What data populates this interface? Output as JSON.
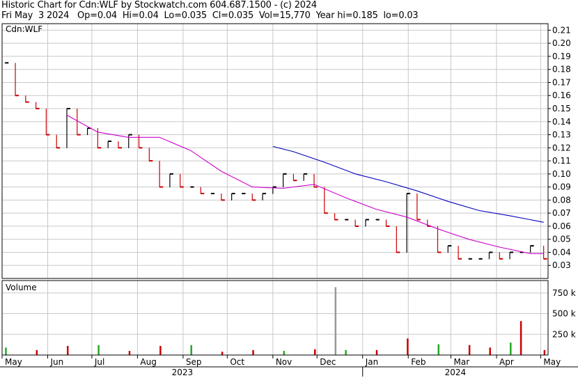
{
  "header": {
    "line1": "Historic Chart for Cdn:WLF by Stockwatch.com 604.687.1500 - (c) 2024",
    "line2": "Fri May  3 2024   Op=0.04  Hi=0.04  Lo=0.035  Cl=0.035  Vol=15,770  Year hi=0.185  lo=0.03"
  },
  "price_panel": {
    "symbol_label": "Cdn:WLF"
  },
  "volume_panel": {
    "label": "Volume"
  },
  "colors": {
    "up": "#000000",
    "down": "#cc0000",
    "ma_short": "#cc00cc",
    "ma_long": "#0000bb",
    "grid": "#c8c8c8"
  },
  "chart_data": {
    "type": "line",
    "title": "Historic Chart for Cdn:WLF",
    "x_axis": {
      "months": [
        "May",
        "Jun",
        "Jul",
        "Aug",
        "Sep",
        "Oct",
        "Nov",
        "Dec",
        "Jan",
        "Feb",
        "Mar",
        "Apr",
        "May"
      ],
      "years": [
        "2023",
        "2024"
      ]
    },
    "y_axis": {
      "ylim": [
        0.02,
        0.215
      ],
      "ticks": [
        "0.03",
        "0.04",
        "0.05",
        "0.06",
        "0.07",
        "0.08",
        "0.09",
        "0.10",
        "0.11",
        "0.12",
        "0.13",
        "0.14",
        "0.15",
        "0.16",
        "0.17",
        "0.18",
        "0.19",
        "0.20",
        "0.21"
      ]
    },
    "volume_axis": {
      "ylim": [
        0,
        900000
      ],
      "ticks": [
        "250 k",
        "500 k",
        "750 k"
      ]
    },
    "series": [
      {
        "name": "Close",
        "x": [
          "2023-05-03",
          "2023-05-10",
          "2023-05-17",
          "2023-05-24",
          "2023-05-31",
          "2023-06-07",
          "2023-06-14",
          "2023-06-21",
          "2023-06-28",
          "2023-07-05",
          "2023-07-12",
          "2023-07-19",
          "2023-07-26",
          "2023-08-02",
          "2023-08-09",
          "2023-08-16",
          "2023-08-23",
          "2023-08-30",
          "2023-09-06",
          "2023-09-13",
          "2023-09-20",
          "2023-09-27",
          "2023-10-04",
          "2023-10-11",
          "2023-10-18",
          "2023-10-25",
          "2023-11-01",
          "2023-11-08",
          "2023-11-15",
          "2023-11-22",
          "2023-11-29",
          "2023-12-06",
          "2023-12-13",
          "2023-12-20",
          "2023-12-27",
          "2024-01-03",
          "2024-01-10",
          "2024-01-17",
          "2024-01-24",
          "2024-01-31",
          "2024-02-07",
          "2024-02-14",
          "2024-02-21",
          "2024-02-28",
          "2024-03-06",
          "2024-03-13",
          "2024-03-20",
          "2024-03-27",
          "2024-04-03",
          "2024-04-10",
          "2024-04-17",
          "2024-04-24",
          "2024-05-03"
        ],
        "values": [
          0.185,
          0.16,
          0.155,
          0.15,
          0.13,
          0.12,
          0.15,
          0.13,
          0.135,
          0.12,
          0.125,
          0.12,
          0.13,
          0.12,
          0.11,
          0.09,
          0.1,
          0.09,
          0.09,
          0.085,
          0.085,
          0.08,
          0.085,
          0.085,
          0.08,
          0.085,
          0.09,
          0.1,
          0.095,
          0.1,
          0.09,
          0.07,
          0.065,
          0.065,
          0.06,
          0.065,
          0.065,
          0.06,
          0.04,
          0.085,
          0.065,
          0.06,
          0.04,
          0.045,
          0.035,
          0.035,
          0.035,
          0.04,
          0.035,
          0.04,
          0.04,
          0.045,
          0.035
        ]
      },
      {
        "name": "Short moving average",
        "x": [
          "2023-06-14",
          "2023-07-05",
          "2023-07-26",
          "2023-08-16",
          "2023-09-06",
          "2023-09-27",
          "2023-10-18",
          "2023-11-08",
          "2023-11-29",
          "2023-12-20",
          "2024-01-10",
          "2024-01-31",
          "2024-02-21",
          "2024-03-13",
          "2024-04-03",
          "2024-04-24",
          "2024-05-03"
        ],
        "values": [
          0.145,
          0.132,
          0.128,
          0.128,
          0.118,
          0.102,
          0.09,
          0.089,
          0.092,
          0.082,
          0.073,
          0.067,
          0.058,
          0.05,
          0.044,
          0.039,
          0.039
        ]
      },
      {
        "name": "Long moving average",
        "x": [
          "2023-11-01",
          "2023-11-15",
          "2023-12-06",
          "2023-12-27",
          "2024-01-17",
          "2024-02-07",
          "2024-02-28",
          "2024-03-20",
          "2024-04-10",
          "2024-05-03"
        ],
        "values": [
          0.121,
          0.117,
          0.109,
          0.1,
          0.094,
          0.087,
          0.079,
          0.072,
          0.068,
          0.063
        ]
      },
      {
        "name": "Volume",
        "x": [
          "2023-05-03",
          "2023-05-24",
          "2023-06-14",
          "2023-07-05",
          "2023-07-26",
          "2023-08-16",
          "2023-09-06",
          "2023-09-27",
          "2023-10-18",
          "2023-11-08",
          "2023-11-29",
          "2023-12-13",
          "2023-12-20",
          "2024-01-10",
          "2024-01-31",
          "2024-02-21",
          "2024-03-13",
          "2024-03-27",
          "2024-04-10",
          "2024-04-17",
          "2024-05-03"
        ],
        "values": [
          90000,
          60000,
          110000,
          120000,
          50000,
          110000,
          120000,
          40000,
          60000,
          50000,
          70000,
          820000,
          60000,
          60000,
          200000,
          130000,
          120000,
          90000,
          150000,
          410000,
          60000
        ]
      }
    ]
  }
}
